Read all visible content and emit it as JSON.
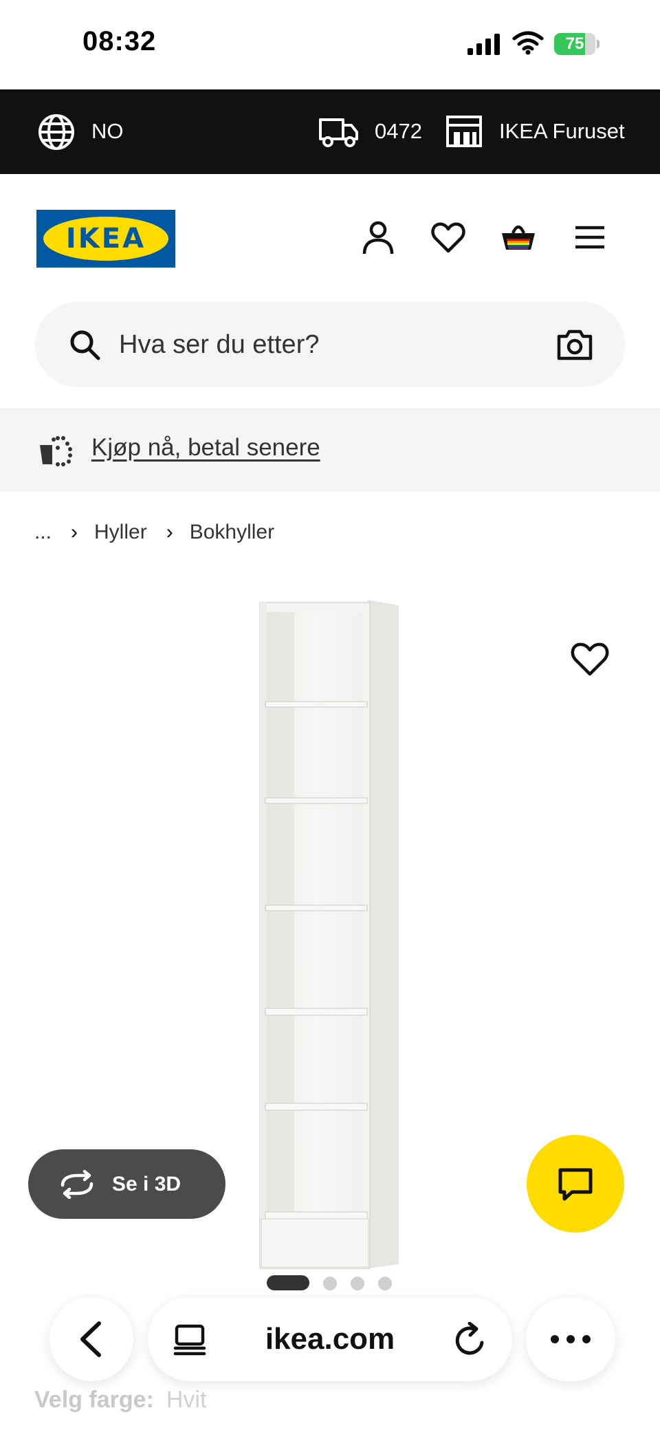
{
  "status_bar": {
    "time": "08:32",
    "battery_percent": 75,
    "battery_label": "75"
  },
  "top_bar": {
    "country": "NO",
    "postal_code": "0472",
    "store": "IKEA Furuset"
  },
  "header": {
    "logo_text": "IKEA",
    "icons": [
      "profile-icon",
      "heart-icon",
      "basket-icon",
      "menu-icon"
    ]
  },
  "search": {
    "placeholder": "Hva ser du etter?"
  },
  "promo": {
    "link_text": "Kjøp nå, betal senere"
  },
  "breadcrumb": {
    "items": [
      "...",
      "Hyller",
      "Bokhyller"
    ]
  },
  "product": {
    "view_3d_label": "Se i 3D",
    "carousel_total": 4,
    "carousel_active": 1
  },
  "color_selector": {
    "label": "Velg farge:",
    "value": "Hvit"
  },
  "browser": {
    "domain": "ikea.com"
  },
  "colors": {
    "ikea_blue": "#0058a3",
    "ikea_yellow": "#ffdb00",
    "top_bar_bg": "#111111",
    "battery_green": "#34c759"
  }
}
